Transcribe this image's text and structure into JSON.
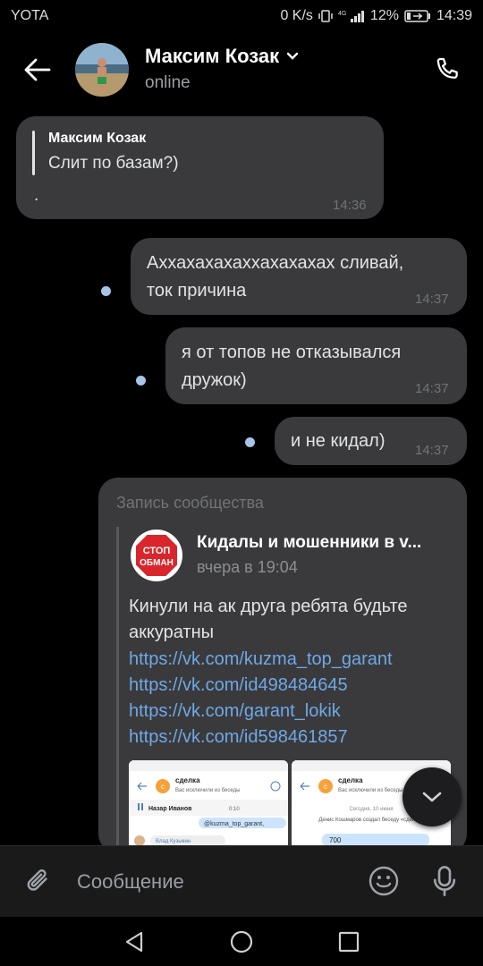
{
  "status_bar": {
    "carrier": "YOTA",
    "speed": "0 K/s",
    "battery": "12%",
    "time": "14:39"
  },
  "header": {
    "name": "Максим Козак",
    "status": "online"
  },
  "messages": {
    "incoming": {
      "reply_author": "Максим Козак",
      "reply_text": "Слит по базам?)",
      "text": ".",
      "time": "14:36"
    },
    "out1": {
      "line1": "Аххахахахаххахахахах сливай,",
      "line2": "ток причина",
      "time": "14:37"
    },
    "out2": {
      "line1": "я от топов не отказывался",
      "line2": "дружок)",
      "time": "14:37"
    },
    "out3": {
      "text": "и не кидал)",
      "time": "14:37"
    }
  },
  "post": {
    "label": "Запись сообщества",
    "community": "Кидалы и мошенники в v...",
    "date": "вчера в 19:04",
    "text_line1": "Кинули на ак друга ребята будьте",
    "text_line2": "аккуратны",
    "links": [
      "https://vk.com/kuzma_top_garant",
      "https://vk.com/id498484645",
      "https://vk.com/garant_lokik",
      "https://vk.com/id598461857"
    ],
    "logo_text_1": "СТОП",
    "logo_text_2": "ОБМАН",
    "thumb1": {
      "title": "сделка",
      "subtitle": "Вас исключили из беседы",
      "row": "Назар Иванов",
      "row_time": "0:10",
      "mention": "@kuzma_top_garant,",
      "user": "Влад Кузьмин"
    },
    "thumb2": {
      "title": "сделка",
      "subtitle": "Вас исключили из беседы",
      "date": "Сегодня, 10 июня",
      "line": "Денис Кошмаров создал беседу «сделка»",
      "value": "700"
    }
  },
  "composer": {
    "placeholder": "Сообщение"
  }
}
